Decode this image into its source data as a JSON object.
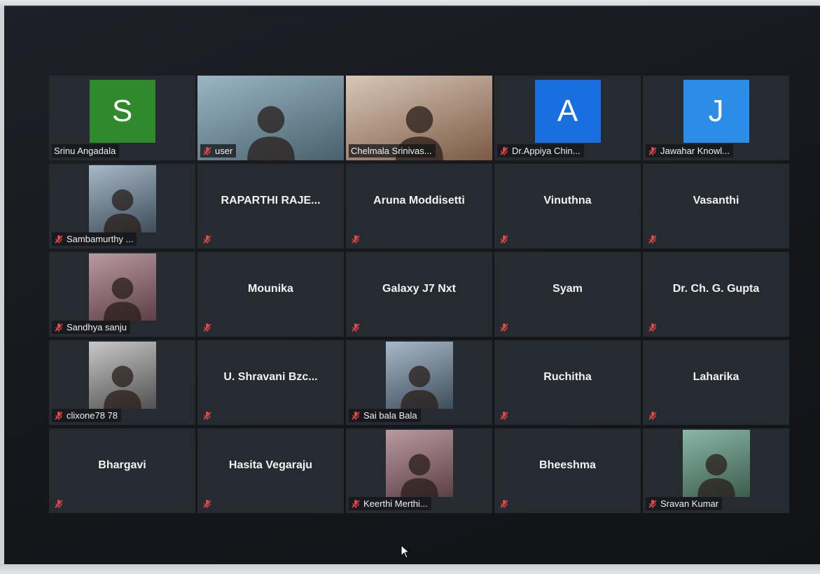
{
  "colors": {
    "tile_bg": "#262a31",
    "active_speaker_border": "#c7e27a",
    "muted_icon": "#e04848"
  },
  "participants": [
    {
      "name": "Srinu Angadala",
      "muted": false,
      "avatar_letter": "S",
      "avatar_color": "#2f8a2c",
      "display": "avatar"
    },
    {
      "name": "user",
      "muted": true,
      "display": "video-wide"
    },
    {
      "name": "Chelmala Srinivas...",
      "muted": false,
      "display": "video-wide",
      "active": true
    },
    {
      "name": "Dr.Appiya Chin...",
      "muted": true,
      "avatar_letter": "A",
      "avatar_color": "#1a6fe0",
      "display": "avatar"
    },
    {
      "name": "Jawahar Knowl...",
      "muted": true,
      "avatar_letter": "J",
      "avatar_color": "#2b8de8",
      "display": "avatar"
    },
    {
      "name": "Sambamurthy ...",
      "muted": true,
      "display": "video"
    },
    {
      "name": "RAPARTHI RAJE...",
      "muted": true,
      "display": "name"
    },
    {
      "name": "Aruna Moddisetti",
      "muted": true,
      "display": "name"
    },
    {
      "name": "Vinuthna",
      "muted": true,
      "display": "name"
    },
    {
      "name": "Vasanthi",
      "muted": true,
      "display": "name"
    },
    {
      "name": "Sandhya sanju",
      "muted": true,
      "display": "video"
    },
    {
      "name": "Mounika",
      "muted": true,
      "display": "name"
    },
    {
      "name": "Galaxy J7 Nxt",
      "muted": true,
      "display": "name"
    },
    {
      "name": "Syam",
      "muted": true,
      "display": "name"
    },
    {
      "name": "Dr. Ch. G. Gupta",
      "muted": true,
      "display": "name"
    },
    {
      "name": "clixone78 78",
      "muted": true,
      "display": "video"
    },
    {
      "name": "U. Shravani Bzc...",
      "muted": true,
      "display": "name"
    },
    {
      "name": "Sai bala Bala",
      "muted": true,
      "display": "video"
    },
    {
      "name": "Ruchitha",
      "muted": true,
      "display": "name"
    },
    {
      "name": "Laharika",
      "muted": true,
      "display": "name"
    },
    {
      "name": "Bhargavi",
      "muted": true,
      "display": "name"
    },
    {
      "name": "Hasita Vegaraju",
      "muted": true,
      "display": "name"
    },
    {
      "name": "Keerthi Merthi...",
      "muted": true,
      "display": "video"
    },
    {
      "name": "Bheeshma",
      "muted": true,
      "display": "name"
    },
    {
      "name": "Sravan Kumar",
      "muted": true,
      "display": "video"
    }
  ]
}
